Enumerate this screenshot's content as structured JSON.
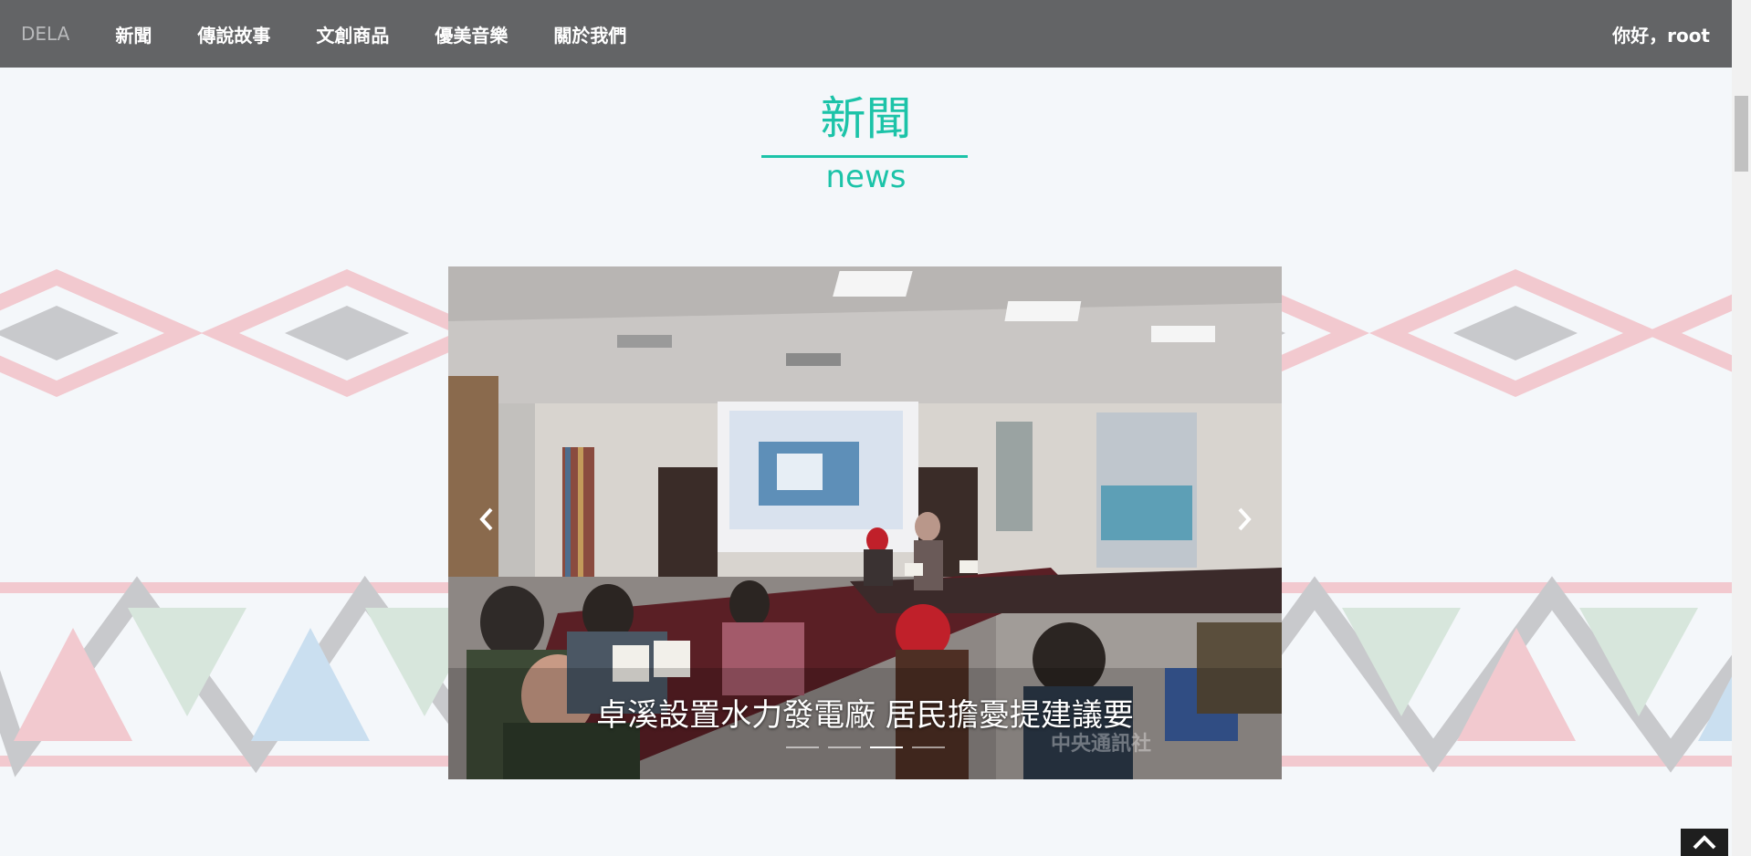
{
  "navbar": {
    "brand": "DELA",
    "items": [
      {
        "label": "新聞"
      },
      {
        "label": "傳說故事"
      },
      {
        "label": "文創商品"
      },
      {
        "label": "優美音樂"
      },
      {
        "label": "關於我們"
      }
    ],
    "greeting": "你好，root"
  },
  "section": {
    "title": "新聞",
    "subtitle": "news"
  },
  "carousel": {
    "caption": "卓溪設置水力發電廠 居民擔憂提建議要",
    "watermark": "中央通訊社",
    "slide_count": 4,
    "active_index": 2,
    "prev_icon": "chevron-left-icon",
    "next_icon": "chevron-right-icon"
  },
  "back_to_top_icon": "chevron-up-icon",
  "colors": {
    "navbar_bg": "#636466",
    "accent": "#1cc3a8",
    "page_bg": "#f4f7fa",
    "deco_pink": "#f2c9cf",
    "deco_gray": "#c8c9cc",
    "deco_green": "#d7e6dc",
    "deco_blue": "#cadff0"
  }
}
